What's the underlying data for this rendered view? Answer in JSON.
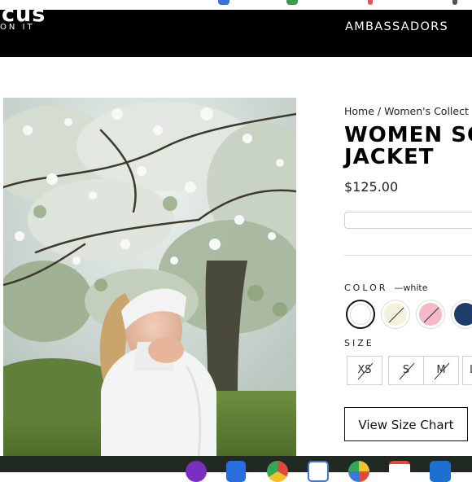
{
  "header": {
    "logo_text": "cus",
    "tagline": "ON IT",
    "nav": [
      "AMBASSADORS"
    ]
  },
  "breadcrumb": {
    "home": "Home",
    "separator": " / ",
    "current": "Women's Collect"
  },
  "product": {
    "title": "WOMEN SO\nJACKET",
    "price": "$125.00",
    "image_alt": "Woman wearing a white headband and white jacket in front of a blossoming tree"
  },
  "color": {
    "label": "COLOR",
    "selected_value": "—white",
    "swatches": [
      {
        "name": "white",
        "hex": "#ffffff",
        "selected": true
      },
      {
        "name": "cream",
        "hex": "#f3f2dc",
        "unavailable": true
      },
      {
        "name": "pink",
        "hex": "#f6b9c8",
        "unavailable": true
      },
      {
        "name": "navy",
        "hex": "#1e3d6b",
        "unavailable": true
      }
    ]
  },
  "size": {
    "label": "SIZE",
    "options": [
      {
        "label": "XS",
        "unavailable": true
      },
      {
        "label": "S",
        "unavailable": true
      },
      {
        "label": "M",
        "unavailable": true
      },
      {
        "label": "L",
        "unavailable": true
      }
    ]
  },
  "size_chart_label": "View Size Chart",
  "colors": {
    "header_bg": "#000000",
    "taskbar_bg": "#202a22"
  },
  "taskbar": {
    "icons": [
      "apps-launcher-icon",
      "google-docs-icon",
      "chrome-icon",
      "calendar-icon",
      "photos-icon",
      "gmail-icon",
      "outlook-icon"
    ]
  }
}
